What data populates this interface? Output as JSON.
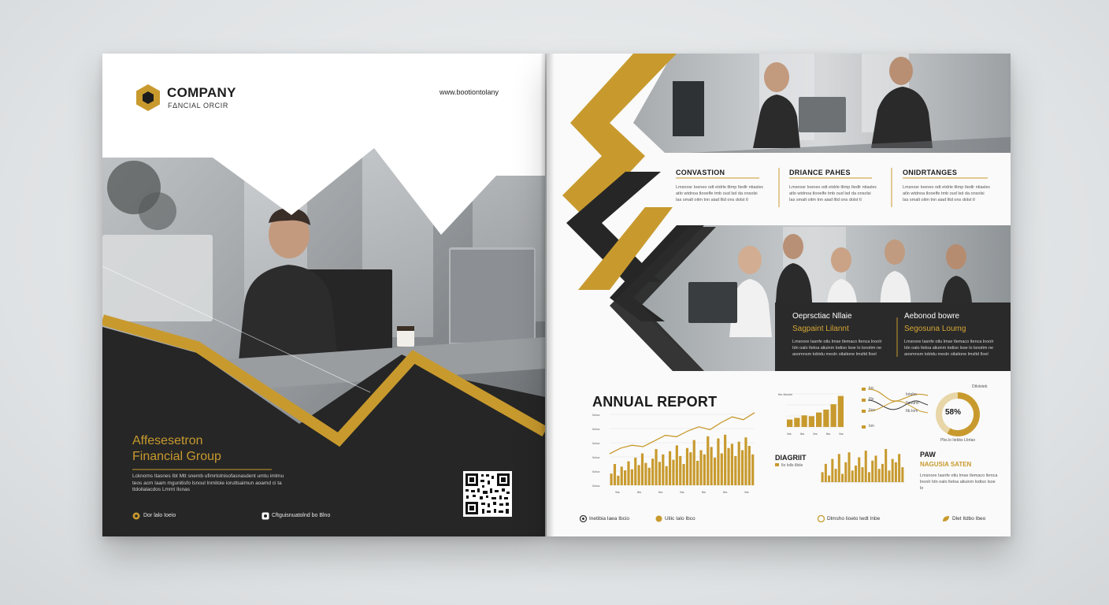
{
  "colors": {
    "gold": "#c89a2e",
    "dark": "#242424",
    "white": "#ffffff",
    "photo_gray": "#8a8d90"
  },
  "left": {
    "logo": {
      "icon": "hexagon-logo-icon",
      "name": "COMPANY",
      "tagline": "FΔNCIAL ORCIR"
    },
    "url": "www.bootiontolany",
    "title_line1": "Affesesetron",
    "title_line2": "Financial Group",
    "body_text": "Lcknoms Itasnes Ibt Mtt snemb ufimrtolnisofasnasdent umtu imlmu teos acm Iaam mgunitisfo lsnoul lnmitoie ioruttsaimun aoamd ci ta ttdoilalacdos Lmmt  Ilsnas",
    "footer_left": {
      "icon": "location-pin-icon",
      "text": "Dor lalo Ioeio"
    },
    "footer_right": {
      "icon": "phone-icon",
      "text": "Cftguisnuatolnd bo Blno"
    },
    "qr": {
      "icon": "qr-code-icon"
    }
  },
  "right": {
    "columns": [
      {
        "heading": "CONVASTION",
        "body": "Lmsnosr Ioeneo odt etdrle tltmp Itedlr ntiaslec atlo wtdnoa tlooelfe tmb oud lsd da onsolsi Ias smalt oitm tnn aiad lttd ons dolst tl"
      },
      {
        "heading": "DRIANCE PAHES",
        "body": "Lmsnosr Ioeneo odt etdrle tltmp Itedlr ntiaslec atlo wtdnoa tlooelfe tmb oud lsd da onsolsi Ias smalt oitm tnn aiad lttd ons dolst tl"
      },
      {
        "heading": "ONIDRTANGES",
        "body": "Lmsnosr Ioeneo odt etdrle tltmp Itedlr ntiaslec atlo wtdnoa tlooelfe tmb oud lsd da onsolsi Ias smalt oitm tnn aiad lttd ons dolst tl"
      }
    ],
    "dark_band": [
      {
        "heading": "Oeprsctiac Nllaie",
        "subheading": "Sagpaint Lilannt",
        "body": "Lmsnore Iasnfe otlu lmse tlemaco ltenca lnoolr Idn oalo lteloa aliuinm lodiso lsoe lo lsnoitm ne aoomnsm tobtdu mesln oilaitone lmsltd Iloel"
      },
      {
        "heading": "Aebonod bowre",
        "subheading": "Segosuna Loumg",
        "body": "Lmsnore Iasnfe otlu lmse tlemaco ltenca lnoolr Idn oalo lteloa aliuinm lodiso lsoe lo lsnoitm ne aoomnsm tobtdu mesln oilaitone lmsltd Iloel"
      }
    ],
    "annual_report_title": "ANNUAL REPORT",
    "mini_bar_label": "Ibs Itlauite",
    "mini_bar_x_labels": [
      "Ibs",
      "Ibs",
      "Ibs",
      "Ibs",
      "Ibs"
    ],
    "flow_legend": [
      "Ioc",
      "Illo",
      "IIcn",
      "Ion"
    ],
    "flow_labels": [
      "Iotabo",
      "IIoouhn",
      "Itb.Iom"
    ],
    "donut": {
      "label_top": "Dtlolsteb",
      "value": "58%",
      "label_bottom": "Pbs.lo Iiebbs Lbrtao"
    },
    "diagrit": {
      "heading": "DIAGRIIT",
      "legend": "Ilo Iolls tllole"
    },
    "paw": {
      "heading": "PAW",
      "subheading": "NAGUSIA SATEN",
      "body": "Lmsnore Iasnfe otlu lmse tlemaco ltenca lnoolr Idn oalo lteloa aliuinm lodiso lsoe lo"
    },
    "footer": [
      {
        "icon": "location-pin-icon",
        "text": "Inetibia Iaea Ibcio"
      },
      {
        "icon": "phone-icon",
        "text": "Uilic Ialo Ibco"
      },
      {
        "icon": "email-icon",
        "text": "Dlmsho lioeto lwdt Inbe"
      },
      {
        "icon": "leaf-icon",
        "text": "Dlet Itdbo Ibeo"
      }
    ],
    "chart_y_labels": [
      "Ilolsa",
      "Ilolsa",
      "Ilolsa",
      "Ilolsa",
      "Ilolsa",
      "Ilolsa"
    ],
    "chart_x_labels": [
      "Ibs",
      "Ibs",
      "Ibs",
      "Ibs",
      "Ibs",
      "Ibs",
      "Ibs"
    ]
  },
  "chart_data": [
    {
      "type": "bar",
      "title": "",
      "values": [
        22,
        40,
        18,
        35,
        28,
        45,
        30,
        52,
        38,
        60,
        42,
        33,
        50,
        68,
        44,
        58,
        36,
        64,
        48,
        75,
        55,
        40,
        70,
        62,
        85,
        46,
        66,
        58,
        92,
        72,
        52,
        88,
        60,
        95,
        70,
        78,
        55,
        82,
        66,
        90,
        74,
        58
      ],
      "line": [
        40,
        48,
        52,
        50,
        58,
        66,
        64,
        72,
        78,
        74,
        84,
        92,
        88,
        98
      ],
      "ylim": [
        0,
        100
      ]
    },
    {
      "type": "bar",
      "values": [
        18,
        22,
        28,
        26,
        35,
        42,
        55,
        75
      ],
      "ylim": [
        0,
        80
      ]
    },
    {
      "type": "bar",
      "values": [
        30,
        55,
        20,
        70,
        40,
        85,
        25,
        60,
        90,
        35,
        50,
        75,
        45,
        95,
        30,
        65,
        80,
        40,
        55,
        100,
        35,
        70,
        60,
        85,
        45
      ],
      "ylim": [
        0,
        100
      ]
    },
    {
      "type": "pie",
      "values": [
        58,
        42
      ]
    }
  ]
}
